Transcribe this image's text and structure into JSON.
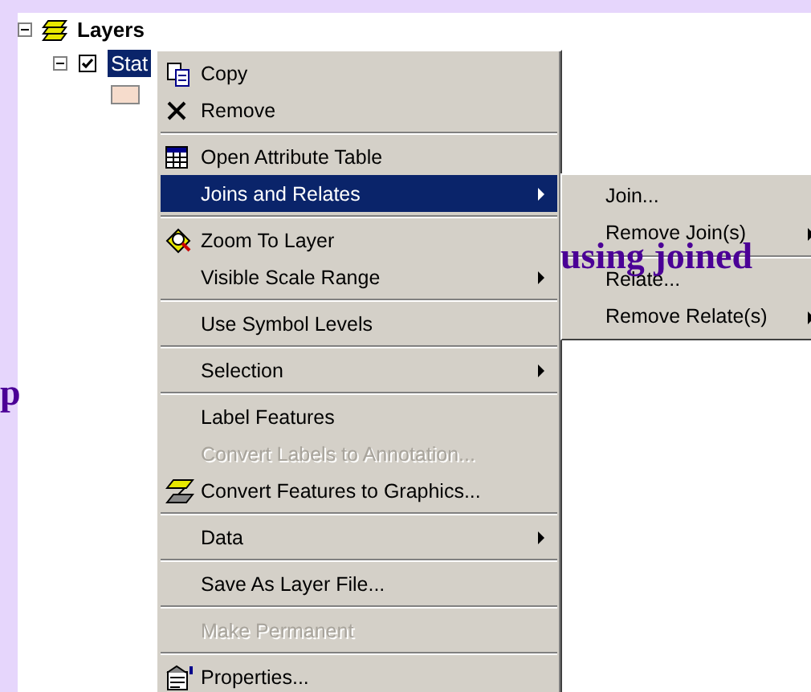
{
  "tree": {
    "root": {
      "label": "Layers",
      "expanded": true
    },
    "layer": {
      "label": "Stat",
      "expanded": true,
      "checked": true,
      "selected": true
    }
  },
  "context_menu": [
    {
      "kind": "copy",
      "label": "Copy",
      "disabled": false,
      "submenu": false,
      "selected": false
    },
    {
      "kind": "remove",
      "label": "Remove",
      "disabled": false,
      "submenu": false,
      "selected": false
    },
    {
      "kind": "separator"
    },
    {
      "kind": "table",
      "label": "Open Attribute Table",
      "disabled": false,
      "submenu": false,
      "selected": false
    },
    {
      "kind": "plain",
      "label": "Joins and Relates",
      "disabled": false,
      "submenu": true,
      "selected": true
    },
    {
      "kind": "separator"
    },
    {
      "kind": "zoom",
      "label": "Zoom To Layer",
      "disabled": false,
      "submenu": false,
      "selected": false
    },
    {
      "kind": "plain",
      "label": "Visible Scale Range",
      "disabled": false,
      "submenu": true,
      "selected": false
    },
    {
      "kind": "separator"
    },
    {
      "kind": "plain",
      "label": "Use Symbol Levels",
      "disabled": false,
      "submenu": false,
      "selected": false
    },
    {
      "kind": "separator"
    },
    {
      "kind": "plain",
      "label": "Selection",
      "disabled": false,
      "submenu": true,
      "selected": false
    },
    {
      "kind": "separator"
    },
    {
      "kind": "plain",
      "label": "Label Features",
      "disabled": false,
      "submenu": false,
      "selected": false
    },
    {
      "kind": "plain",
      "label": "Convert Labels to Annotation...",
      "disabled": true,
      "submenu": false,
      "selected": false
    },
    {
      "kind": "graphics",
      "label": "Convert Features to Graphics...",
      "disabled": false,
      "submenu": false,
      "selected": false
    },
    {
      "kind": "separator"
    },
    {
      "kind": "plain",
      "label": "Data",
      "disabled": false,
      "submenu": true,
      "selected": false
    },
    {
      "kind": "separator"
    },
    {
      "kind": "plain",
      "label": "Save As Layer File...",
      "disabled": false,
      "submenu": false,
      "selected": false
    },
    {
      "kind": "separator"
    },
    {
      "kind": "plain",
      "label": "Make Permanent",
      "disabled": true,
      "submenu": false,
      "selected": false
    },
    {
      "kind": "separator"
    },
    {
      "kind": "properties",
      "label": "Properties...",
      "disabled": false,
      "submenu": false,
      "selected": false
    }
  ],
  "submenu": [
    {
      "kind": "item",
      "label": "Join...",
      "submenu": false
    },
    {
      "kind": "item",
      "label": "Remove Join(s)",
      "submenu": true
    },
    {
      "kind": "separator"
    },
    {
      "kind": "item",
      "label": "Relate...",
      "submenu": false
    },
    {
      "kind": "item",
      "label": "Remove Relate(s)",
      "submenu": true
    }
  ],
  "slide_text": [
    {
      "text": "using joined"
    },
    {
      "text": "p"
    }
  ]
}
